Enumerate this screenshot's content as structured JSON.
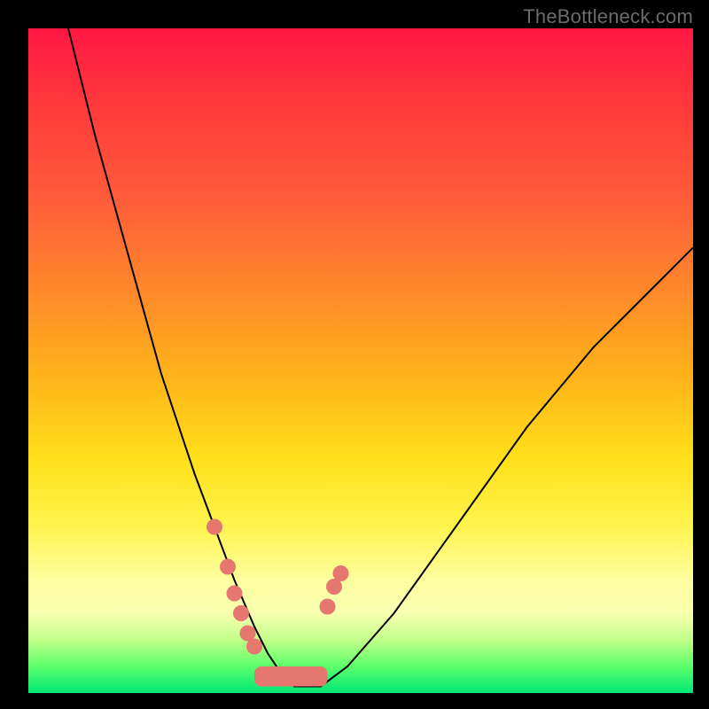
{
  "watermark": "TheBottleneck.com",
  "chart_data": {
    "type": "line",
    "title": "",
    "xlabel": "",
    "ylabel": "",
    "xlim": [
      0,
      100
    ],
    "ylim": [
      0,
      100
    ],
    "background_gradient": {
      "top_color": "#ff1744",
      "mid_color": "#ffe01a",
      "bottom_color": "#00e676",
      "meaning": "value scale from high (red) to low (green)"
    },
    "series": [
      {
        "name": "bottleneck-curve",
        "x": [
          6,
          10,
          15,
          20,
          25,
          28,
          31,
          34,
          36,
          38,
          40,
          44,
          48,
          55,
          65,
          75,
          85,
          95,
          100
        ],
        "y": [
          100,
          84,
          66,
          48,
          33,
          25,
          17,
          10,
          6,
          3,
          1,
          1,
          4,
          12,
          26,
          40,
          52,
          62,
          67
        ]
      }
    ],
    "highlight_points": {
      "comment": "salmon dotted markers near curve minimum and flat bottom band",
      "points": [
        {
          "x": 28,
          "y": 25
        },
        {
          "x": 30,
          "y": 19
        },
        {
          "x": 31,
          "y": 15
        },
        {
          "x": 32,
          "y": 12
        },
        {
          "x": 33,
          "y": 9
        },
        {
          "x": 34,
          "y": 7
        },
        {
          "x": 45,
          "y": 13
        },
        {
          "x": 46,
          "y": 16
        },
        {
          "x": 47,
          "y": 18
        }
      ],
      "bottom_band": {
        "x_start": 34,
        "x_end": 45,
        "y": 1,
        "height": 3
      }
    },
    "minimum": {
      "x": 41,
      "y": 0.5
    }
  }
}
